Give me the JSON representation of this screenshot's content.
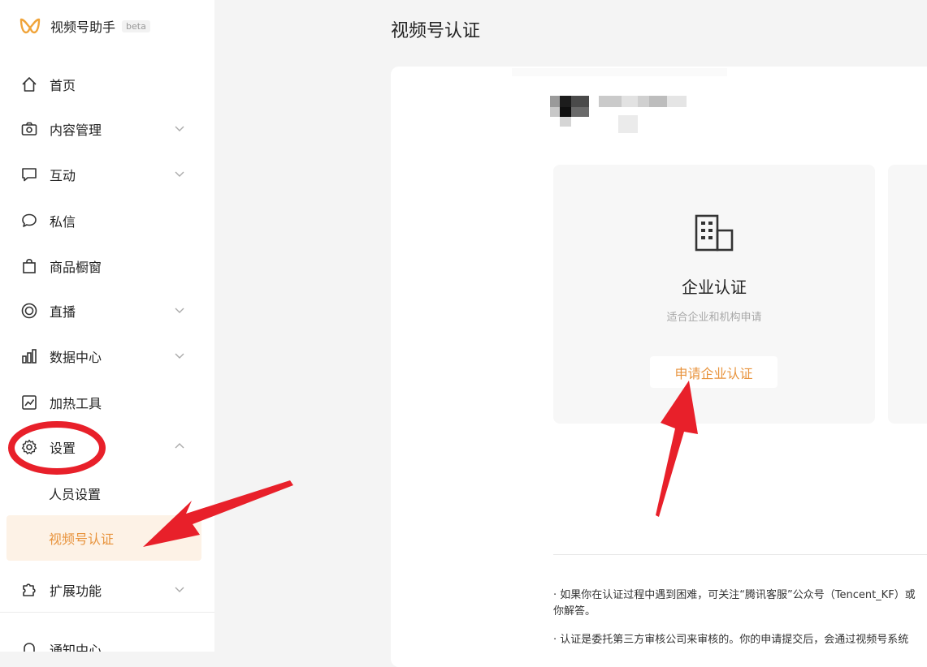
{
  "brand": {
    "name": "视频号助手",
    "badge": "beta"
  },
  "sidebar": {
    "items": [
      {
        "label": "首页"
      },
      {
        "label": "内容管理"
      },
      {
        "label": "互动"
      },
      {
        "label": "私信"
      },
      {
        "label": "商品橱窗"
      },
      {
        "label": "直播"
      },
      {
        "label": "数据中心"
      },
      {
        "label": "加热工具"
      },
      {
        "label": "设置"
      },
      {
        "label": "扩展功能"
      },
      {
        "label": "通知中心"
      }
    ],
    "settings_sub": [
      {
        "label": "人员设置"
      },
      {
        "label": "视频号认证",
        "active": true
      }
    ]
  },
  "main": {
    "title": "视频号认证",
    "option": {
      "title": "企业认证",
      "subtitle": "适合企业和机构申请",
      "button": "申请企业认证"
    },
    "notes": [
      "· 如果你在认证过程中遇到困难，可关注“腾讯客服”公众号（Tencent_KF）或",
      "你解答。",
      "· 认证是委托第三方审核公司来审核的。你的申请提交后，会通过视频号系统"
    ]
  },
  "colors": {
    "accent": "#e8933c",
    "active_bg": "#fdf2e6",
    "annotation_red": "#e8202a"
  }
}
